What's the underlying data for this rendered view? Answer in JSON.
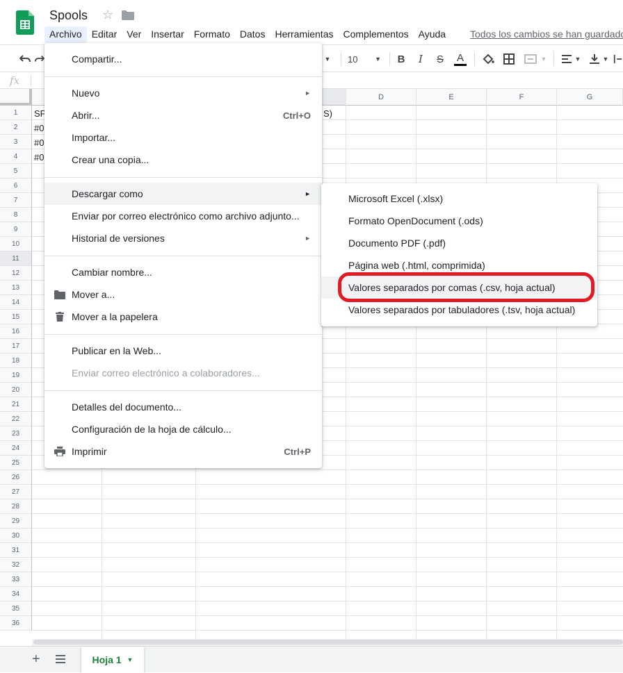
{
  "app": {
    "doc_title": "Spools",
    "save_status": "Todos los cambios se han guardado"
  },
  "menubar": [
    "Archivo",
    "Editar",
    "Ver",
    "Insertar",
    "Formato",
    "Datos",
    "Herramientas",
    "Complementos",
    "Ayuda"
  ],
  "toolbar": {
    "font_size": "10",
    "buttons": [
      "undo-icon",
      "redo-icon",
      "font-size-select",
      "bold-icon",
      "italic-icon",
      "strikethrough-icon",
      "text-color-icon",
      "fill-color-icon",
      "borders-icon",
      "merge-cells-icon",
      "horizontal-align-icon",
      "vertical-align-icon",
      "text-wrap-icon"
    ],
    "bold": "B",
    "italic": "I",
    "strike": "S",
    "text_color": "A"
  },
  "formula_bar": {
    "fx": "fx"
  },
  "grid": {
    "columns": [
      "D",
      "E",
      "F",
      "G"
    ],
    "rows": [
      "1",
      "2",
      "3",
      "4",
      "5",
      "6",
      "7",
      "8",
      "9",
      "10",
      "11",
      "12",
      "13",
      "14",
      "15",
      "16",
      "17",
      "18",
      "19",
      "20",
      "21",
      "22",
      "23",
      "24",
      "25",
      "26",
      "27",
      "28",
      "29",
      "30",
      "31",
      "32",
      "33",
      "34",
      "35",
      "36"
    ],
    "visible_cells": {
      "a1": "SP",
      "a2": "#0",
      "a3": "#0",
      "a4": "#0",
      "c1_tail": "S)"
    },
    "selected_row": "11"
  },
  "sheets": {
    "active_tab": "Hoja 1"
  },
  "file_menu": {
    "items": [
      {
        "label": "Compartir..."
      },
      {
        "label": "Nuevo",
        "submenu": true
      },
      {
        "label": "Abrir...",
        "shortcut": "Ctrl+O"
      },
      {
        "label": "Importar..."
      },
      {
        "label": "Crear una copia..."
      },
      {
        "label": "Descargar como",
        "submenu": true
      },
      {
        "label": "Enviar por correo electrónico como archivo adjunto..."
      },
      {
        "label": "Historial de versiones",
        "submenu": true
      },
      {
        "label": "Cambiar nombre..."
      },
      {
        "label": "Mover a..."
      },
      {
        "label": "Mover a la papelera"
      },
      {
        "label": "Publicar en la Web..."
      },
      {
        "label": "Enviar correo electrónico a colaboradores..."
      },
      {
        "label": "Detalles del documento..."
      },
      {
        "label": "Configuración de la hoja de cálculo..."
      },
      {
        "label": "Imprimir",
        "shortcut": "Ctrl+P"
      }
    ]
  },
  "download_submenu": {
    "items": [
      {
        "label": "Microsoft Excel (.xlsx)"
      },
      {
        "label": "Formato OpenDocument (.ods)"
      },
      {
        "label": "Documento PDF (.pdf)"
      },
      {
        "label": "Página web (.html, comprimida)"
      },
      {
        "label": "Valores separados por comas (.csv, hoja actual)"
      },
      {
        "label": "Valores separados por tabuladores (.tsv, hoja actual)"
      }
    ]
  },
  "colors": {
    "brand_green": "#0f9d58",
    "highlight_ring": "#e01b24",
    "active_tab_text": "#188038"
  }
}
